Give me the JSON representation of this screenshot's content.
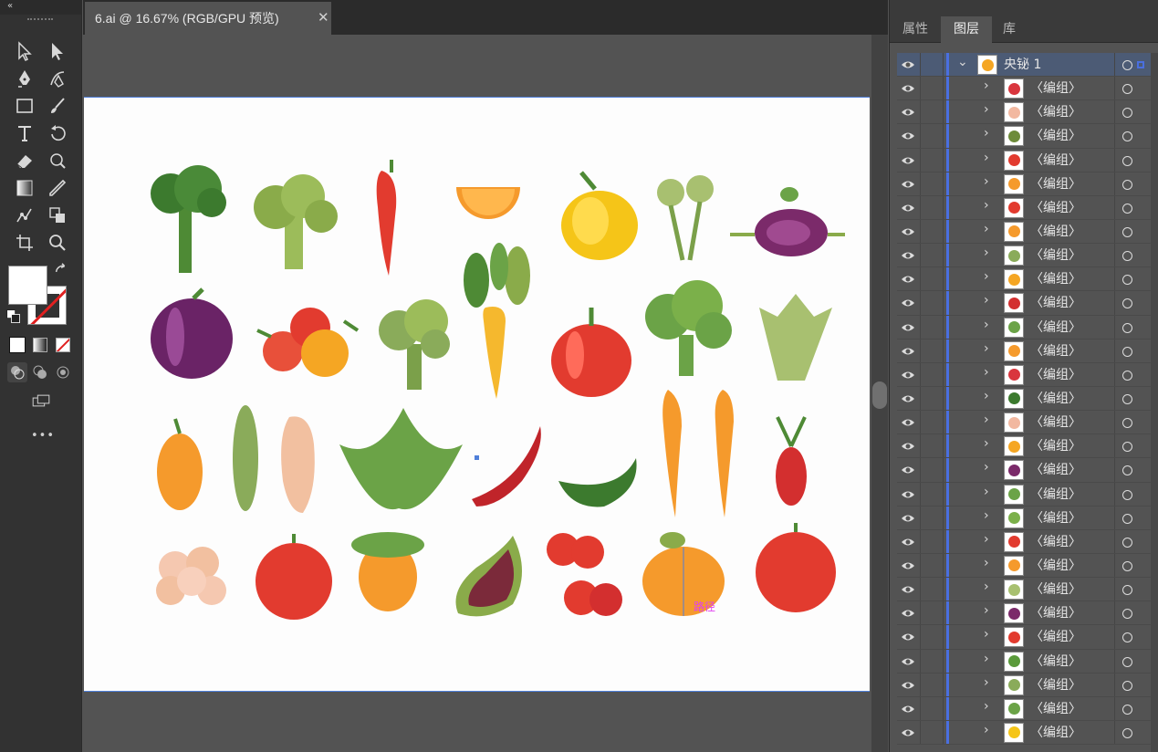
{
  "document_tab": {
    "title": "6.ai @ 16.67% (RGB/GPU 预览)",
    "close": "✕"
  },
  "toolbar": {
    "collapse": "«",
    "more": "•••",
    "tools": [
      "selection-tool",
      "direct-selection-tool",
      "pen-tool",
      "curvature-tool",
      "rectangle-tool",
      "paintbrush-tool",
      "type-tool",
      "rotate-tool",
      "eraser-tool",
      "warp-tool",
      "gradient-tool",
      "eyedropper-tool",
      "puppet-warp-tool",
      "shape-builder-tool",
      "artboard-tool",
      "zoom-tool"
    ]
  },
  "panel": {
    "tabs": [
      "属性",
      "图层",
      "库"
    ],
    "active_tab": "图层",
    "top_layer": {
      "name": "央铋 1"
    },
    "layer_rows": [
      {
        "label": "〈编组〉",
        "color": "#d9363e"
      },
      {
        "label": "〈编组〉",
        "color": "#f2b8a0"
      },
      {
        "label": "〈编组〉",
        "color": "#6d8b3a"
      },
      {
        "label": "〈编组〉",
        "color": "#e23b2f"
      },
      {
        "label": "〈编组〉",
        "color": "#f59a2c"
      },
      {
        "label": "〈编组〉",
        "color": "#e23b2f"
      },
      {
        "label": "〈编组〉",
        "color": "#f59a2c"
      },
      {
        "label": "〈编组〉",
        "color": "#8aab5a"
      },
      {
        "label": "〈编组〉",
        "color": "#f5a623"
      },
      {
        "label": "〈编组〉",
        "color": "#d32f2f"
      },
      {
        "label": "〈编组〉",
        "color": "#6ba347"
      },
      {
        "label": "〈编组〉",
        "color": "#f59a2c"
      },
      {
        "label": "〈编组〉",
        "color": "#d9363e"
      },
      {
        "label": "〈编组〉",
        "color": "#3c7a2e"
      },
      {
        "label": "〈编组〉",
        "color": "#f2b8a0"
      },
      {
        "label": "〈编组〉",
        "color": "#f5a623"
      },
      {
        "label": "〈编组〉",
        "color": "#7b2a6a"
      },
      {
        "label": "〈编组〉",
        "color": "#6ba347"
      },
      {
        "label": "〈编组〉",
        "color": "#7bb04a"
      },
      {
        "label": "〈编组〉",
        "color": "#e23b2f"
      },
      {
        "label": "〈编组〉",
        "color": "#f59a2c"
      },
      {
        "label": "〈编组〉",
        "color": "#a8c070"
      },
      {
        "label": "〈编组〉",
        "color": "#7b2a6a"
      },
      {
        "label": "〈编组〉",
        "color": "#e23b2f"
      },
      {
        "label": "〈编组〉",
        "color": "#5a9a3a"
      },
      {
        "label": "〈编组〉",
        "color": "#8aab5a"
      },
      {
        "label": "〈编组〉",
        "color": "#6ba347"
      },
      {
        "label": "〈编组〉",
        "color": "#f5c518"
      }
    ]
  },
  "artboard": {
    "path_label": "路径"
  },
  "colors": {
    "accent": "#4a6fe0",
    "layer_highlight": "#4c5b75",
    "ui_dark": "#323232",
    "ui_mid": "#535353"
  }
}
